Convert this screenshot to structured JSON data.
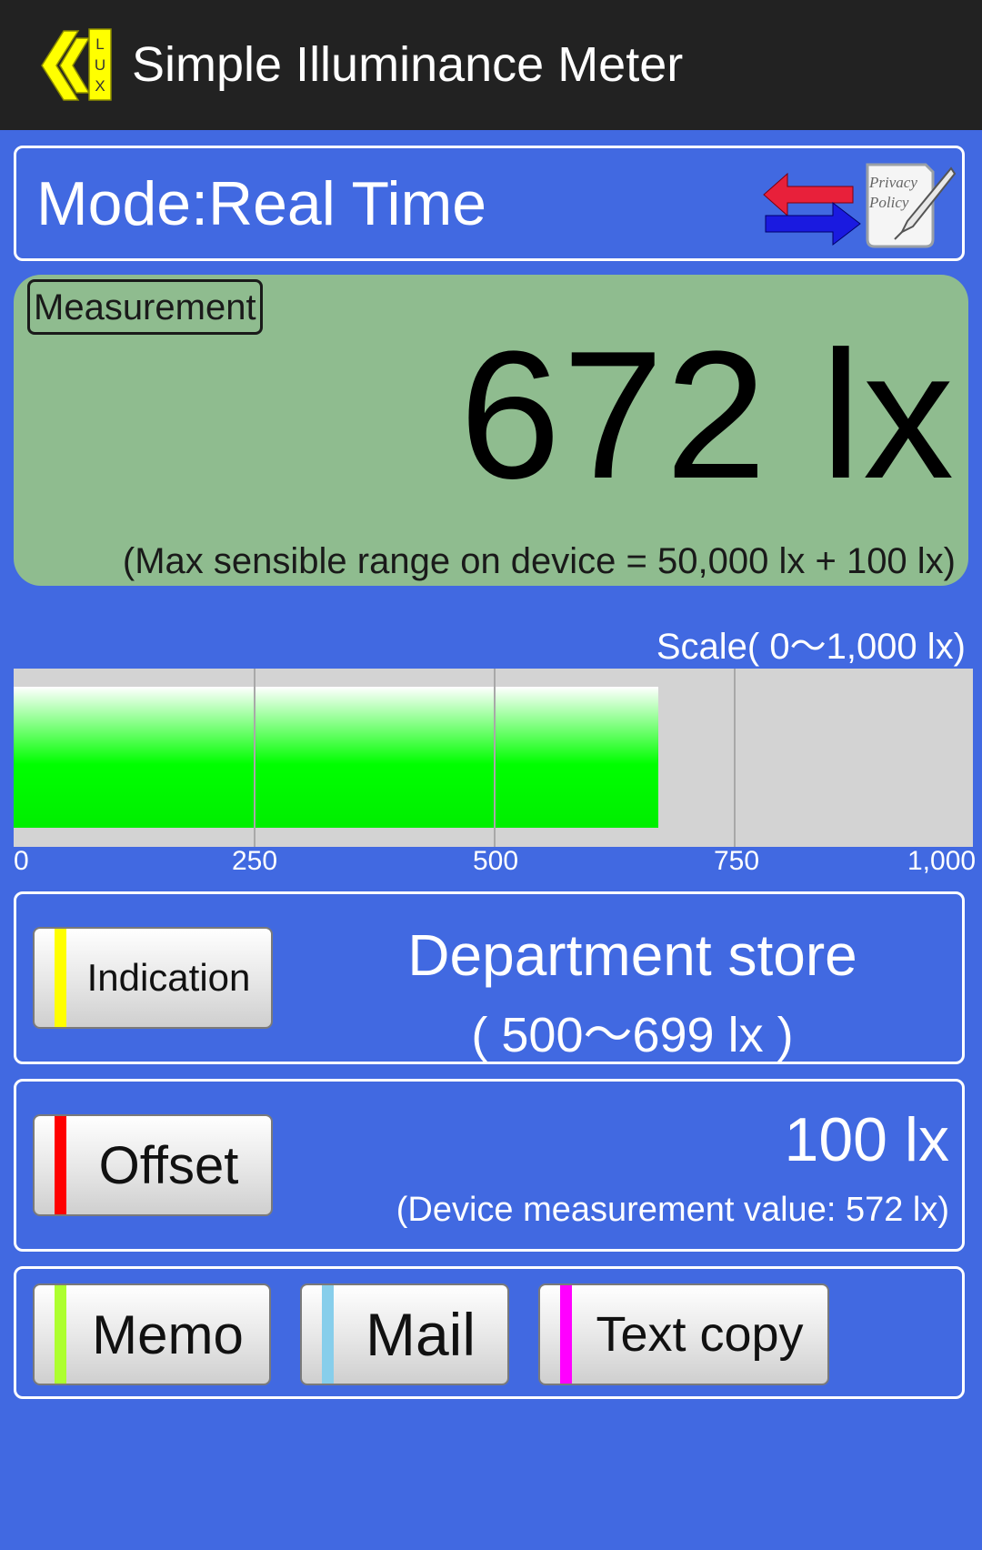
{
  "app_bar": {
    "title": "Simple Illuminance Meter",
    "logo_letters": [
      "L",
      "U",
      "X"
    ]
  },
  "mode_panel": {
    "mode_text": "Mode:Real Time",
    "switch_icon": "swap-arrows-icon",
    "privacy_icon": "privacy-policy-icon",
    "privacy_icon_lines": [
      "Privacy",
      "Policy"
    ]
  },
  "measurement": {
    "label": "Measurement",
    "value": "672 lx",
    "range_note": "(Max sensible range on device = 50,000 lx + 100 lx)"
  },
  "scale": {
    "title": "Scale(  0〜1,000 lx)",
    "min": 0,
    "max": 1000,
    "current": 672,
    "ticks": [
      "0",
      "250",
      "500",
      "750",
      "1,000"
    ]
  },
  "indication": {
    "button_label": "Indication",
    "category": "Department store",
    "category_range": "( 500〜699 lx )"
  },
  "offset": {
    "button_label": "Offset",
    "value": "100 lx",
    "device_value": "(Device measurement value: 572 lx)"
  },
  "actions": {
    "memo_label": "Memo",
    "mail_label": "Mail",
    "text_copy_label": "Text copy"
  },
  "colors": {
    "background": "#4169e1",
    "app_bar": "#222222",
    "measurement_panel": "#8fbc8f",
    "bar_fill": "#00ff00",
    "bar_track": "#d3d3d3",
    "indication_stripe": "#ffff00",
    "offset_stripe": "#ff0000",
    "memo_stripe": "#adff2f",
    "mail_stripe": "#87ceeb",
    "text_copy_stripe": "#ff00ff"
  }
}
